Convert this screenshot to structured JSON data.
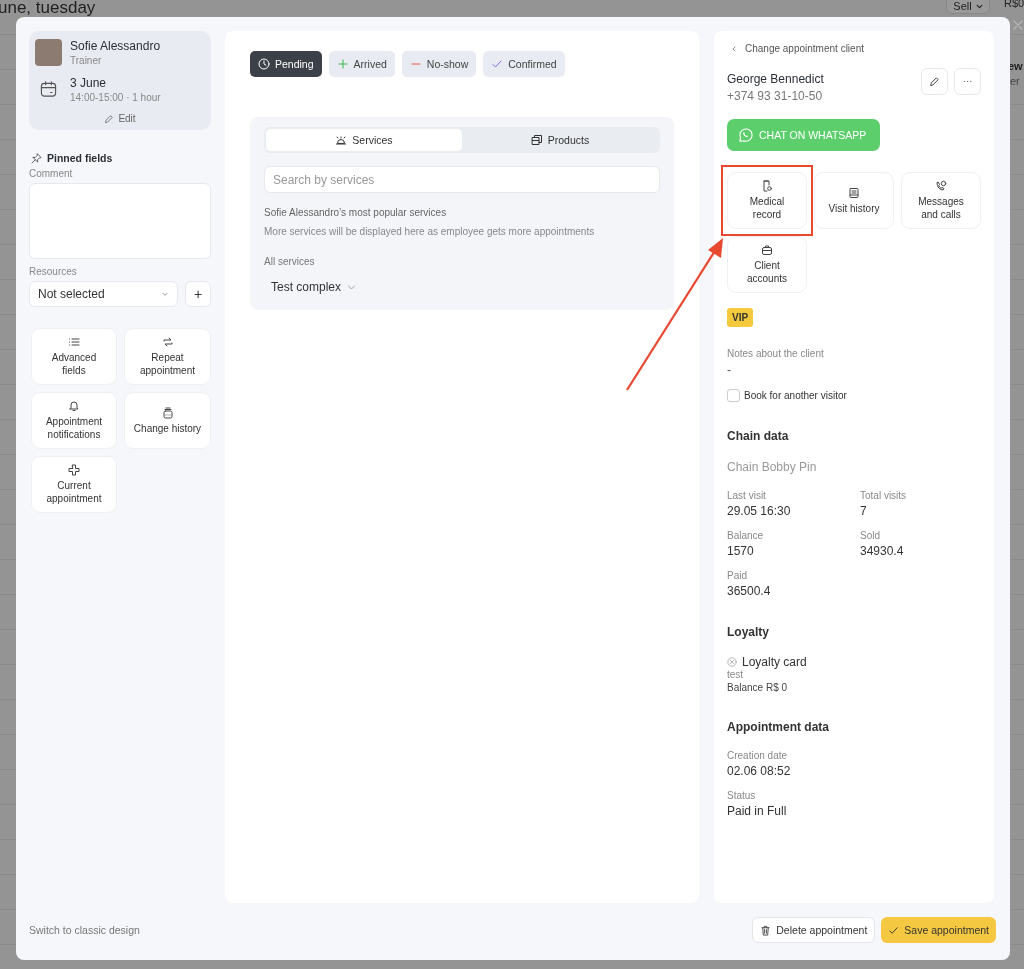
{
  "background": {
    "title": "une, tuesday",
    "sell_button": "Sell",
    "amount": "R$0",
    "column_text_1": "ew",
    "column_text_2": "er"
  },
  "employee": {
    "name": "Sofie Alessandro",
    "role": "Trainer",
    "date": "3 June",
    "time": "14:00-15:00 · 1 hour",
    "edit": "Edit"
  },
  "pinned_fields": {
    "title": "Pinned fields",
    "comment_label": "Comment",
    "resources_label": "Resources",
    "resources_value": "Not selected",
    "add": "+"
  },
  "left_actions": [
    {
      "label": "Advanced\nfields",
      "kind": "list"
    },
    {
      "label": "Repeat\nappointment",
      "kind": "repeat"
    },
    {
      "label": "Appointment\nnotifications",
      "kind": "bell"
    },
    {
      "label": "Change history",
      "kind": "history"
    },
    {
      "label": "Current\nappointment",
      "kind": "cross"
    }
  ],
  "statuses": [
    {
      "label": "Pending",
      "kind": "pending",
      "selected": true
    },
    {
      "label": "Arrived",
      "kind": "arrived",
      "selected": false
    },
    {
      "label": "No-show",
      "kind": "no_show",
      "selected": false
    },
    {
      "label": "Confirmed",
      "kind": "confirmed",
      "selected": false
    }
  ],
  "product_tabs": [
    {
      "label": "Services",
      "kind": "services",
      "selected": true
    },
    {
      "label": "Products",
      "kind": "products",
      "selected": false
    }
  ],
  "search": {
    "placeholder": "Search by services"
  },
  "popular_title": "Sofie Alessandro’s most popular services",
  "popular_hint": "More services will be displayed here as employee gets more appointments",
  "all_services": "All services",
  "category": "Test complex",
  "client": {
    "back": "Change appointment client",
    "name": "George Bennedict",
    "phone": "+374 93 31-10-50",
    "whatsapp": "CHAT ON WHATSAPP"
  },
  "client_actions": [
    {
      "label": "Medical\nrecord",
      "kind": "medical",
      "highlighted": true
    },
    {
      "label": "Visit history",
      "kind": "visits",
      "highlighted": false
    },
    {
      "label": "Messages\nand calls",
      "kind": "messages",
      "highlighted": false
    },
    {
      "label": "Client\naccounts",
      "kind": "accounts",
      "highlighted": false
    }
  ],
  "tag": "VIP",
  "notes": {
    "label": "Notes about the client",
    "value": "-"
  },
  "book_other": {
    "label": "Book for another visitor",
    "checked": false
  },
  "chain": {
    "title": "Chain data",
    "name": "Chain Bobby Pin",
    "fields": [
      {
        "label": "Last visit",
        "value": "29.05 16:30"
      },
      {
        "label": "Total visits",
        "value": "7"
      },
      {
        "label": "Balance",
        "value": "1570"
      },
      {
        "label": "Sold",
        "value": "34930.4"
      },
      {
        "label": "Paid",
        "value": "36500.4"
      }
    ]
  },
  "loyalty": {
    "title": "Loyalty",
    "card": "Loyalty card",
    "note": "test",
    "balance": "Balance R$ 0"
  },
  "appointment_data": {
    "title": "Appointment data",
    "fields": [
      {
        "label": "Creation date",
        "value": "02.06 08:52"
      },
      {
        "label": "Status",
        "value": "Paid in Full"
      }
    ]
  },
  "footer": {
    "switch": "Switch to classic design",
    "delete": "Delete appointment",
    "save": "Save appointment"
  }
}
